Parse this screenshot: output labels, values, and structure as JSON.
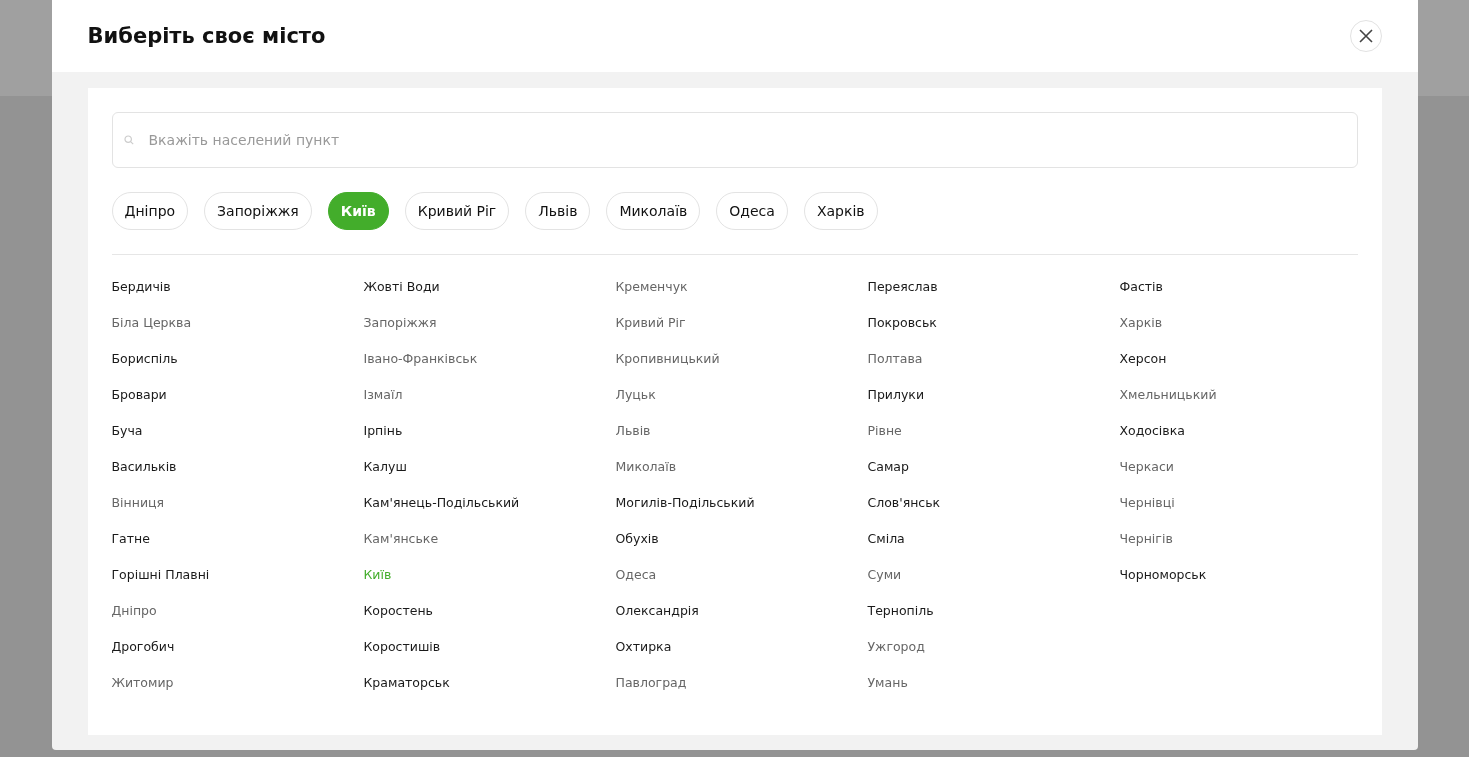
{
  "dialog": {
    "title": "Виберіть своє місто"
  },
  "search": {
    "placeholder": "Вкажіть населений пункт"
  },
  "quick_cities": [
    {
      "label": "Дніпро",
      "selected": false
    },
    {
      "label": "Запоріжжя",
      "selected": false
    },
    {
      "label": "Київ",
      "selected": true
    },
    {
      "label": "Кривий Ріг",
      "selected": false
    },
    {
      "label": "Львів",
      "selected": false
    },
    {
      "label": "Миколаїв",
      "selected": false
    },
    {
      "label": "Одеса",
      "selected": false
    },
    {
      "label": "Харків",
      "selected": false
    }
  ],
  "cities": [
    {
      "name": "Бердичів",
      "muted": false,
      "selected": false
    },
    {
      "name": "Біла Церква",
      "muted": true,
      "selected": false
    },
    {
      "name": "Бориспіль",
      "muted": false,
      "selected": false
    },
    {
      "name": "Бровари",
      "muted": false,
      "selected": false
    },
    {
      "name": "Буча",
      "muted": false,
      "selected": false
    },
    {
      "name": "Васильків",
      "muted": false,
      "selected": false
    },
    {
      "name": "Вінниця",
      "muted": true,
      "selected": false
    },
    {
      "name": "Гатне",
      "muted": false,
      "selected": false
    },
    {
      "name": "Горішні Плавні",
      "muted": false,
      "selected": false
    },
    {
      "name": "Дніпро",
      "muted": true,
      "selected": false
    },
    {
      "name": "Дрогобич",
      "muted": false,
      "selected": false
    },
    {
      "name": "Житомир",
      "muted": true,
      "selected": false
    },
    {
      "name": "Жовті Води",
      "muted": false,
      "selected": false
    },
    {
      "name": "Запоріжжя",
      "muted": true,
      "selected": false
    },
    {
      "name": "Івано-Франківськ",
      "muted": true,
      "selected": false
    },
    {
      "name": "Ізмаїл",
      "muted": true,
      "selected": false
    },
    {
      "name": "Ірпінь",
      "muted": false,
      "selected": false
    },
    {
      "name": "Калуш",
      "muted": false,
      "selected": false
    },
    {
      "name": "Кам'янець-Подільський",
      "muted": false,
      "selected": false
    },
    {
      "name": "Кам'янське",
      "muted": true,
      "selected": false
    },
    {
      "name": "Київ",
      "muted": true,
      "selected": true
    },
    {
      "name": "Коростень",
      "muted": false,
      "selected": false
    },
    {
      "name": "Коростишів",
      "muted": false,
      "selected": false
    },
    {
      "name": "Краматорськ",
      "muted": false,
      "selected": false
    },
    {
      "name": "Кременчук",
      "muted": true,
      "selected": false
    },
    {
      "name": "Кривий Ріг",
      "muted": true,
      "selected": false
    },
    {
      "name": "Кропивницький",
      "muted": true,
      "selected": false
    },
    {
      "name": "Луцьк",
      "muted": true,
      "selected": false
    },
    {
      "name": "Львів",
      "muted": true,
      "selected": false
    },
    {
      "name": "Миколаїв",
      "muted": true,
      "selected": false
    },
    {
      "name": "Могилів-Подільський",
      "muted": false,
      "selected": false
    },
    {
      "name": "Обухів",
      "muted": false,
      "selected": false
    },
    {
      "name": "Одеса",
      "muted": true,
      "selected": false
    },
    {
      "name": "Олександрія",
      "muted": false,
      "selected": false
    },
    {
      "name": "Охтирка",
      "muted": false,
      "selected": false
    },
    {
      "name": "Павлоград",
      "muted": true,
      "selected": false
    },
    {
      "name": "Переяслав",
      "muted": false,
      "selected": false
    },
    {
      "name": "Покровськ",
      "muted": false,
      "selected": false
    },
    {
      "name": "Полтава",
      "muted": true,
      "selected": false
    },
    {
      "name": "Прилуки",
      "muted": false,
      "selected": false
    },
    {
      "name": "Рівне",
      "muted": true,
      "selected": false
    },
    {
      "name": "Самар",
      "muted": false,
      "selected": false
    },
    {
      "name": "Слов'янськ",
      "muted": false,
      "selected": false
    },
    {
      "name": "Сміла",
      "muted": false,
      "selected": false
    },
    {
      "name": "Суми",
      "muted": true,
      "selected": false
    },
    {
      "name": "Тернопіль",
      "muted": false,
      "selected": false
    },
    {
      "name": "Ужгород",
      "muted": true,
      "selected": false
    },
    {
      "name": "Умань",
      "muted": true,
      "selected": false
    },
    {
      "name": "Фастів",
      "muted": false,
      "selected": false
    },
    {
      "name": "Харків",
      "muted": true,
      "selected": false
    },
    {
      "name": "Херсон",
      "muted": false,
      "selected": false
    },
    {
      "name": "Хмельницький",
      "muted": true,
      "selected": false
    },
    {
      "name": "Ходосівка",
      "muted": false,
      "selected": false
    },
    {
      "name": "Черкаси",
      "muted": true,
      "selected": false
    },
    {
      "name": "Чернівці",
      "muted": true,
      "selected": false
    },
    {
      "name": "Чернігів",
      "muted": true,
      "selected": false
    },
    {
      "name": "Чорноморськ",
      "muted": false,
      "selected": false
    }
  ]
}
